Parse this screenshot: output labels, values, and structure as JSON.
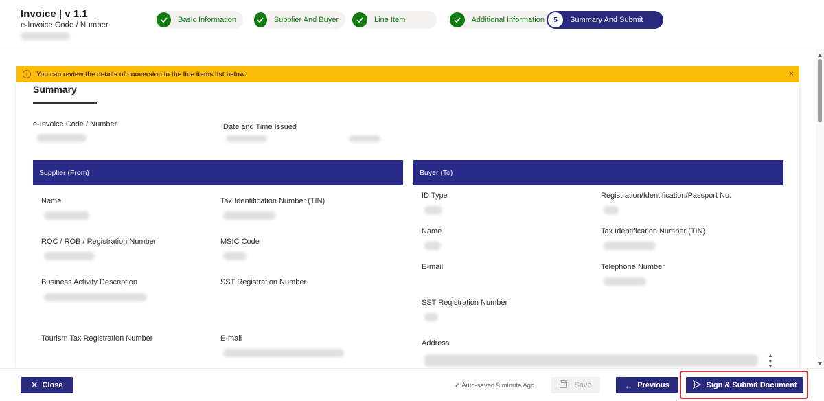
{
  "header": {
    "title": "Invoice | v 1.1",
    "subtitle": "e-Invoice Code / Number"
  },
  "steps": [
    {
      "label": "Basic Information",
      "status": "complete"
    },
    {
      "label": "Supplier And Buyer",
      "status": "complete"
    },
    {
      "label": "Line Item",
      "status": "complete"
    },
    {
      "label": "Additional Information",
      "status": "complete"
    },
    {
      "number": "5",
      "label": "Summary And Submit",
      "status": "active"
    }
  ],
  "banner": {
    "message": "You can review the details of conversion in the line items list below.",
    "close": "×",
    "info": "i"
  },
  "summary": {
    "title": "Summary",
    "invoice_code_label": "e-Invoice Code / Number",
    "date_issued_label": "Date and Time Issued"
  },
  "supplier": {
    "heading": "Supplier (From)",
    "name_label": "Name",
    "tin_label": "Tax Identification Number (TIN)",
    "roc_label": "ROC / ROB / Registration Number",
    "msic_label": "MSIC Code",
    "activity_label": "Business Activity Description",
    "sst_label": "SST Registration Number",
    "tourism_label": "Tourism Tax Registration Number",
    "email_label": "E-mail"
  },
  "buyer": {
    "heading": "Buyer (To)",
    "id_type_label": "ID Type",
    "reg_label": "Registration/Identification/Passport No.",
    "name_label": "Name",
    "tin_label": "Tax Identification Number (TIN)",
    "email_label": "E-mail",
    "phone_label": "Telephone Number",
    "sst_label": "SST Registration Number",
    "address_label": "Address"
  },
  "footer": {
    "close_label": "Close",
    "autosave_text": "Auto-saved 9 minute Ago",
    "save_label": "Save",
    "previous_label": "Previous",
    "submit_label": "Sign & Submit Document"
  },
  "colors": {
    "primary": "#292a7d",
    "success": "#107c10",
    "warning": "#fbbc05",
    "highlight": "#d13438"
  }
}
